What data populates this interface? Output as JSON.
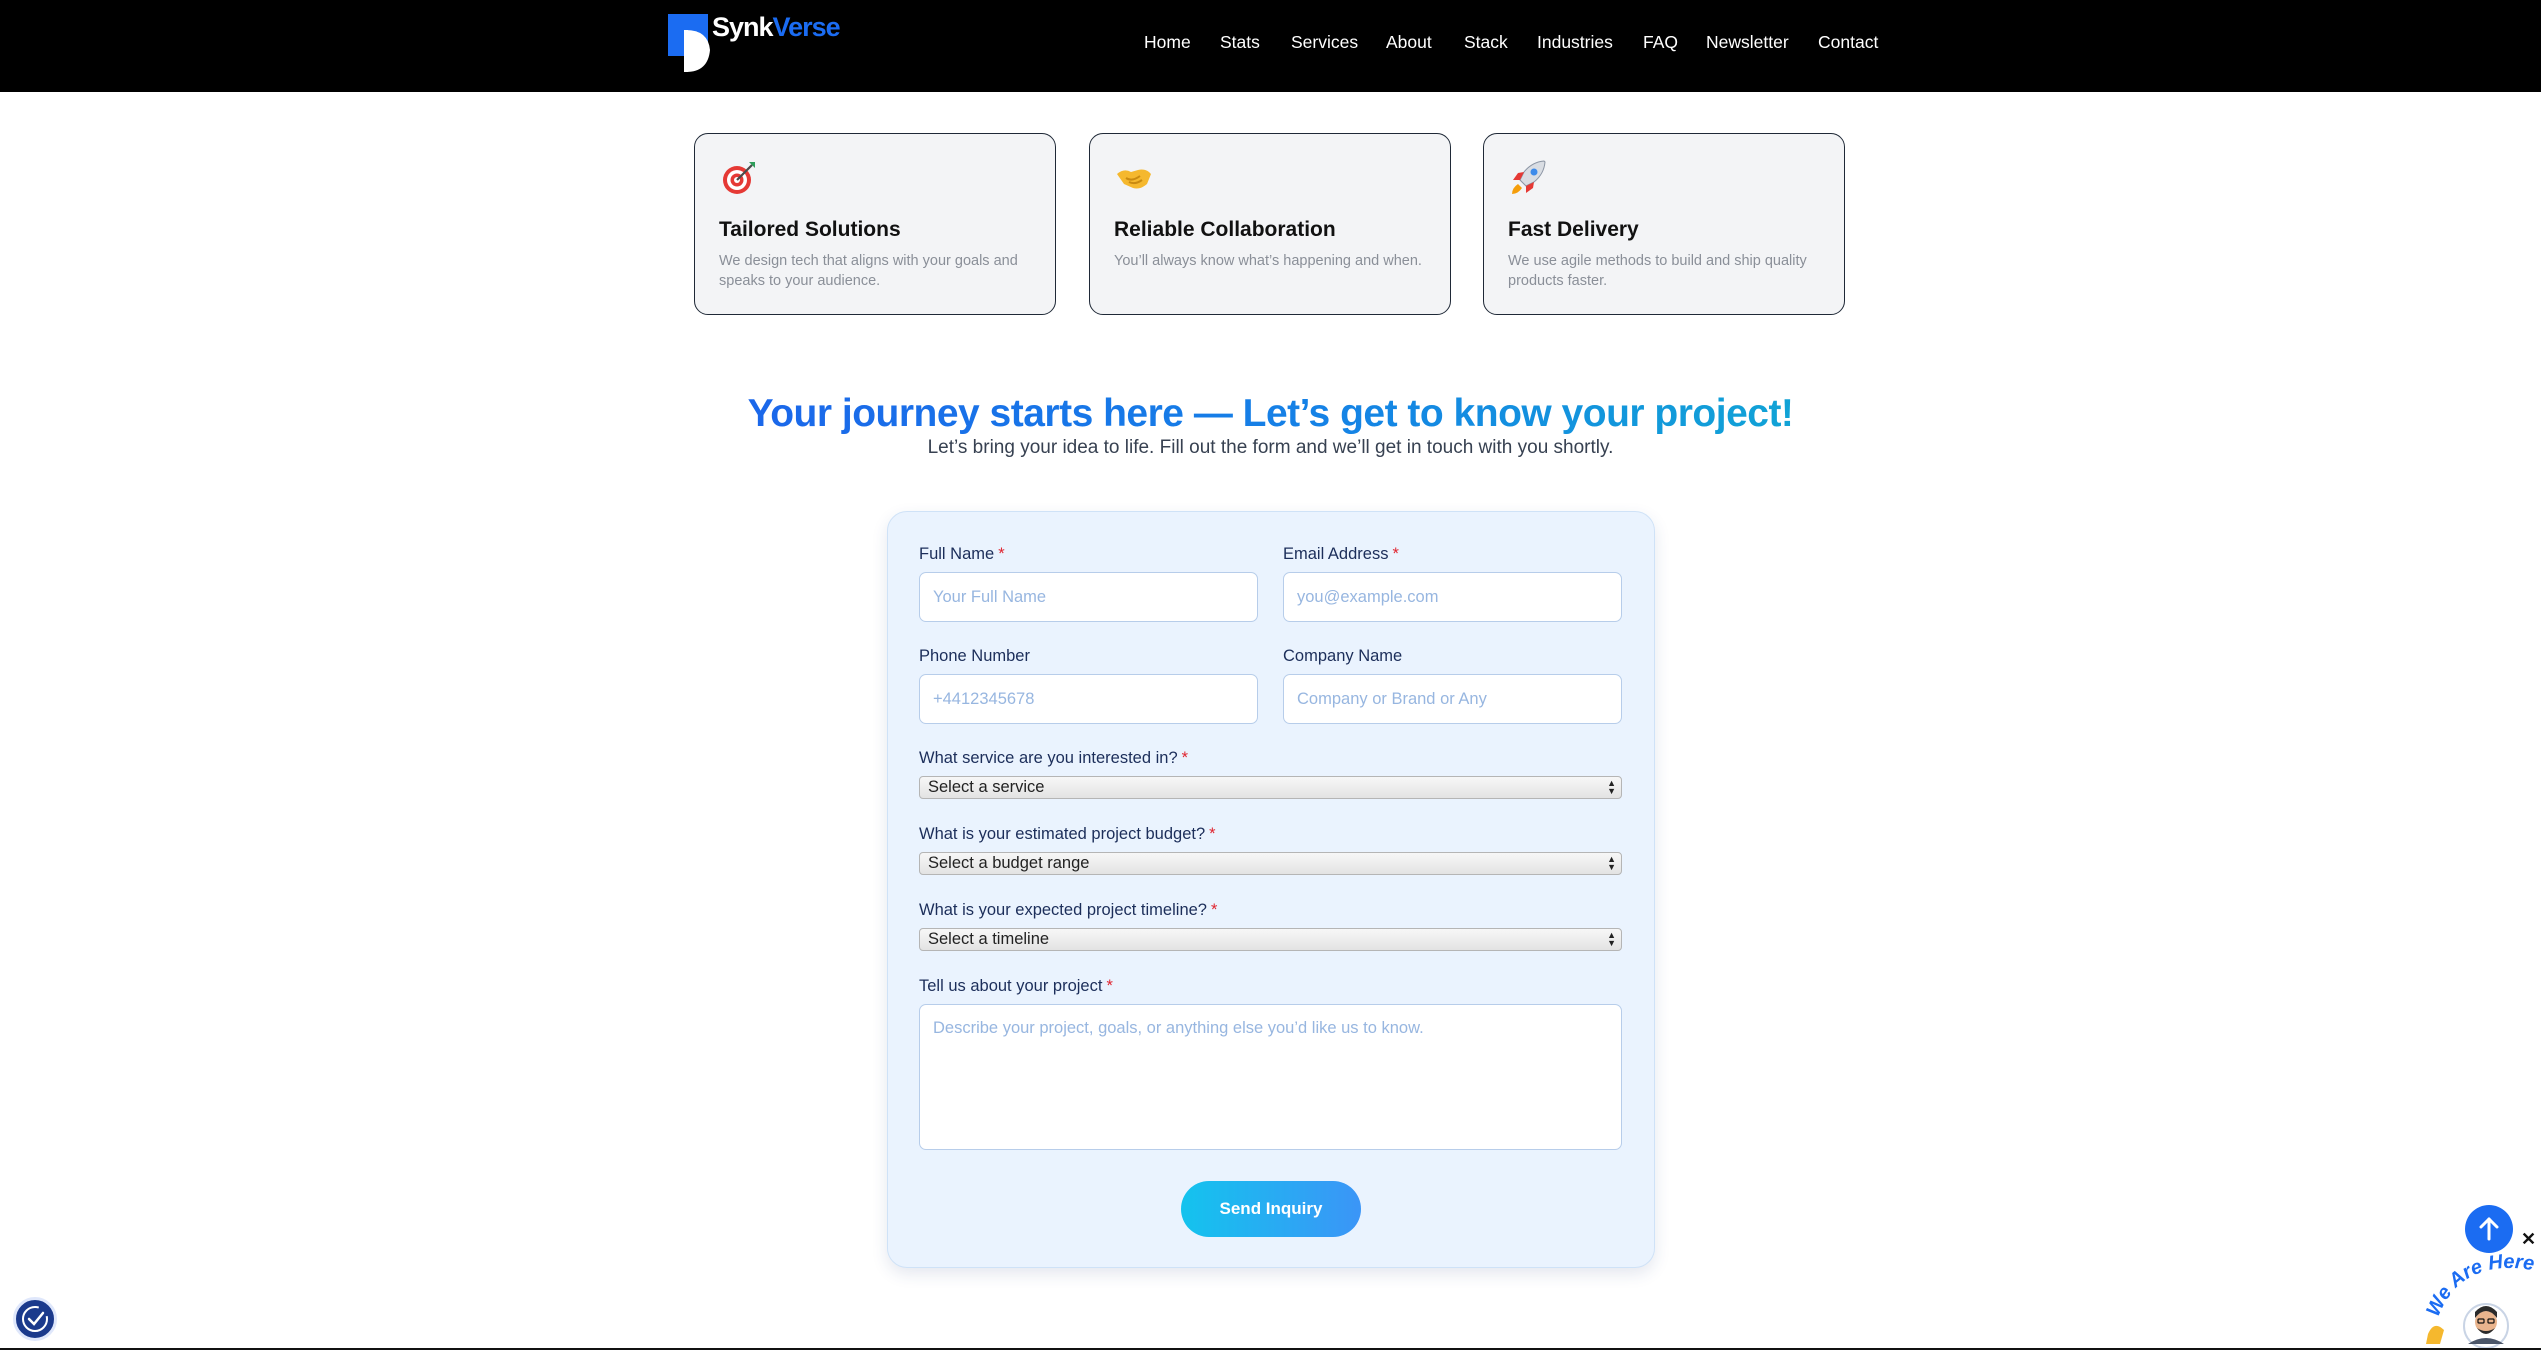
{
  "header": {
    "brand": {
      "part1": "Synk",
      "part2": "Verse"
    },
    "nav": [
      "Home",
      "Stats",
      "Services",
      "About",
      "Stack",
      "Industries",
      "FAQ",
      "Newsletter",
      "Contact"
    ]
  },
  "features": [
    {
      "icon": "target-icon",
      "title": "Tailored Solutions",
      "desc": "We design tech that aligns with your goals and speaks to your audience."
    },
    {
      "icon": "handshake-icon",
      "title": "Reliable Collaboration",
      "desc": "You’ll always know what’s happening and when."
    },
    {
      "icon": "rocket-icon",
      "title": "Fast Delivery",
      "desc": "We use agile methods to build and ship quality products faster."
    }
  ],
  "hero": {
    "headline": "Your journey starts here — Let’s get to know your project!",
    "subline": "Let’s bring your idea to life. Fill out the form and we’ll get in touch with you shortly."
  },
  "form": {
    "full_name": {
      "label": "Full Name",
      "required": "*",
      "placeholder": "Your Full Name",
      "value": ""
    },
    "email": {
      "label": "Email Address",
      "required": "*",
      "placeholder": "you@example.com",
      "value": ""
    },
    "phone": {
      "label": "Phone Number",
      "placeholder": "+4412345678",
      "value": ""
    },
    "company": {
      "label": "Company Name",
      "placeholder": "Company or Brand or Any",
      "value": ""
    },
    "service": {
      "label": "What service are you interested in?",
      "required": "*",
      "selected": "Select a service"
    },
    "budget": {
      "label": "What is your estimated project budget?",
      "required": "*",
      "selected": "Select a budget range"
    },
    "timeline": {
      "label": "What is your expected project timeline?",
      "required": "*",
      "selected": "Select a timeline"
    },
    "project": {
      "label": "Tell us about your project",
      "required": "*",
      "placeholder": "Describe your project, goals, or anything else you’d like us to know.",
      "value": ""
    },
    "submit_label": "Send Inquiry"
  },
  "widgets": {
    "chat_badge_text": "We Are Here!",
    "close_glyph": "✕",
    "accessibility_icon": "accessibility-icon",
    "back_to_top_icon": "arrow-up-icon"
  },
  "colors": {
    "brand_blue": "#1b6cf2",
    "header_bg": "#000000",
    "form_bg": "#eaf3fe",
    "required": "#e0242f",
    "button_gradient_start": "#14c3ee",
    "button_gradient_end": "#3b95f7"
  }
}
